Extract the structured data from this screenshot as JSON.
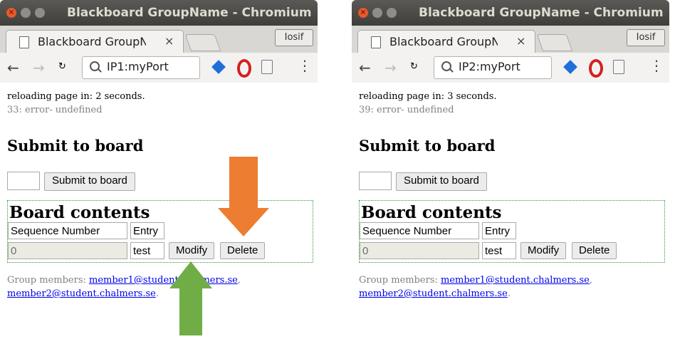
{
  "windows": [
    {
      "title": "Blackboard GroupName - Chromium",
      "tab_label": "Blackboard GroupN",
      "tab_close": "×",
      "profile": "Iosif",
      "url": "IP1:myPort",
      "reload_text": "reloading page in: 2 seconds.",
      "error_text": "33: error- undefined",
      "submit_heading": "Submit to board",
      "submit_button": "Submit to board",
      "board_heading": "Board contents",
      "col_seq": "Sequence Number",
      "col_entry": "Entry",
      "row_seq": "0",
      "row_entry": "test",
      "modify_button": "Modify",
      "delete_button": "Delete",
      "members_prefix": "Group members: ",
      "member1": "member1@student.chalmers.se",
      "member2": "member2@student.chalmers.se",
      "sep": ",",
      "end": "."
    },
    {
      "title": "Blackboard GroupName - Chromium",
      "tab_label": "Blackboard GroupN",
      "tab_close": "×",
      "profile": "Iosif",
      "url": "IP2:myPort",
      "reload_text": "reloading page in: 3 seconds.",
      "error_text": "39: error- undefined",
      "submit_heading": "Submit to board",
      "submit_button": "Submit to board",
      "board_heading": "Board contents",
      "col_seq": "Sequence Number",
      "col_entry": "Entry",
      "row_seq": "0",
      "row_entry": "test",
      "modify_button": "Modify",
      "delete_button": "Delete",
      "members_prefix": "Group members: ",
      "member1": "member1@student.chalmers.se",
      "member2": "member2@student.chalmers.se",
      "sep": ",",
      "end": "."
    }
  ],
  "icons": {
    "close": "close-icon",
    "minimize": "minimize-icon",
    "maximize": "maximize-icon",
    "page": "page-icon",
    "back": "back-arrow-icon",
    "forward": "forward-arrow-icon",
    "reload": "reload-icon",
    "search": "search-icon",
    "extension": "diamond-extension-icon",
    "opera": "opera-icon",
    "document": "document-icon",
    "menu": "kebab-menu-icon"
  },
  "colors": {
    "arrow_orange": "#ed7d31",
    "arrow_green": "#70ad47",
    "board_border": "#2e9a2e"
  }
}
